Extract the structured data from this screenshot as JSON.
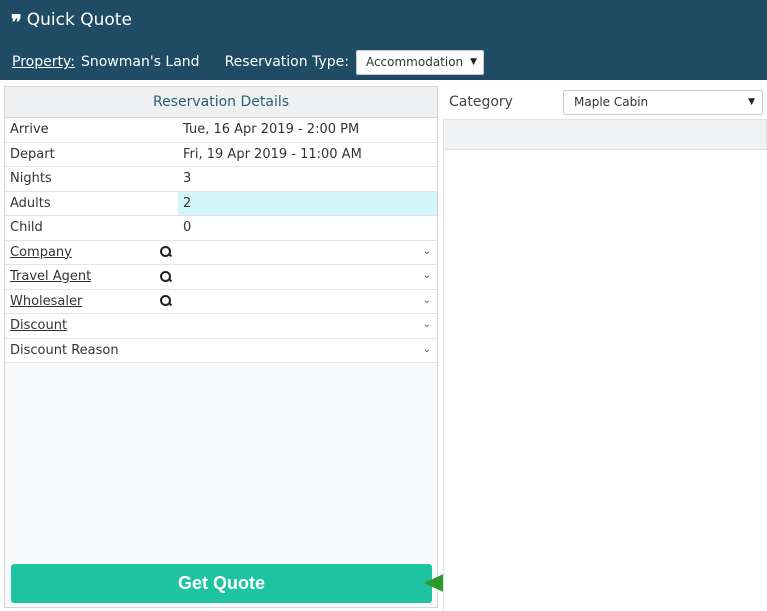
{
  "header": {
    "icon": "quote-icon",
    "title": "Quick Quote",
    "property_label": "Property:",
    "property_value": "Snowman's Land",
    "reservation_type_label": "Reservation Type:",
    "reservation_type_value": "Accommodation"
  },
  "reservation": {
    "heading": "Reservation Details",
    "rows": [
      {
        "label": "Arrive",
        "value": "Tue, 16 Apr 2019 - 2:00 PM"
      },
      {
        "label": "Depart",
        "value": "Fri, 19 Apr 2019 - 11:00 AM"
      },
      {
        "label": "Nights",
        "value": "3"
      },
      {
        "label": "Adults",
        "value": "2"
      },
      {
        "label": "Child",
        "value": "0"
      },
      {
        "label": "Company",
        "value": ""
      },
      {
        "label": "Travel Agent",
        "value": ""
      },
      {
        "label": "Wholesaler",
        "value": ""
      },
      {
        "label": "Discount",
        "value": ""
      },
      {
        "label": "Discount Reason",
        "value": ""
      }
    ],
    "button_label": "Get Quote"
  },
  "category": {
    "label": "Category",
    "selected": "Maple Cabin"
  },
  "colors": {
    "header_bg": "#1f4b64",
    "button_bg": "#1dc49f",
    "highlight_bg": "#d3f6fb",
    "arrow": "#2e9a2e"
  }
}
